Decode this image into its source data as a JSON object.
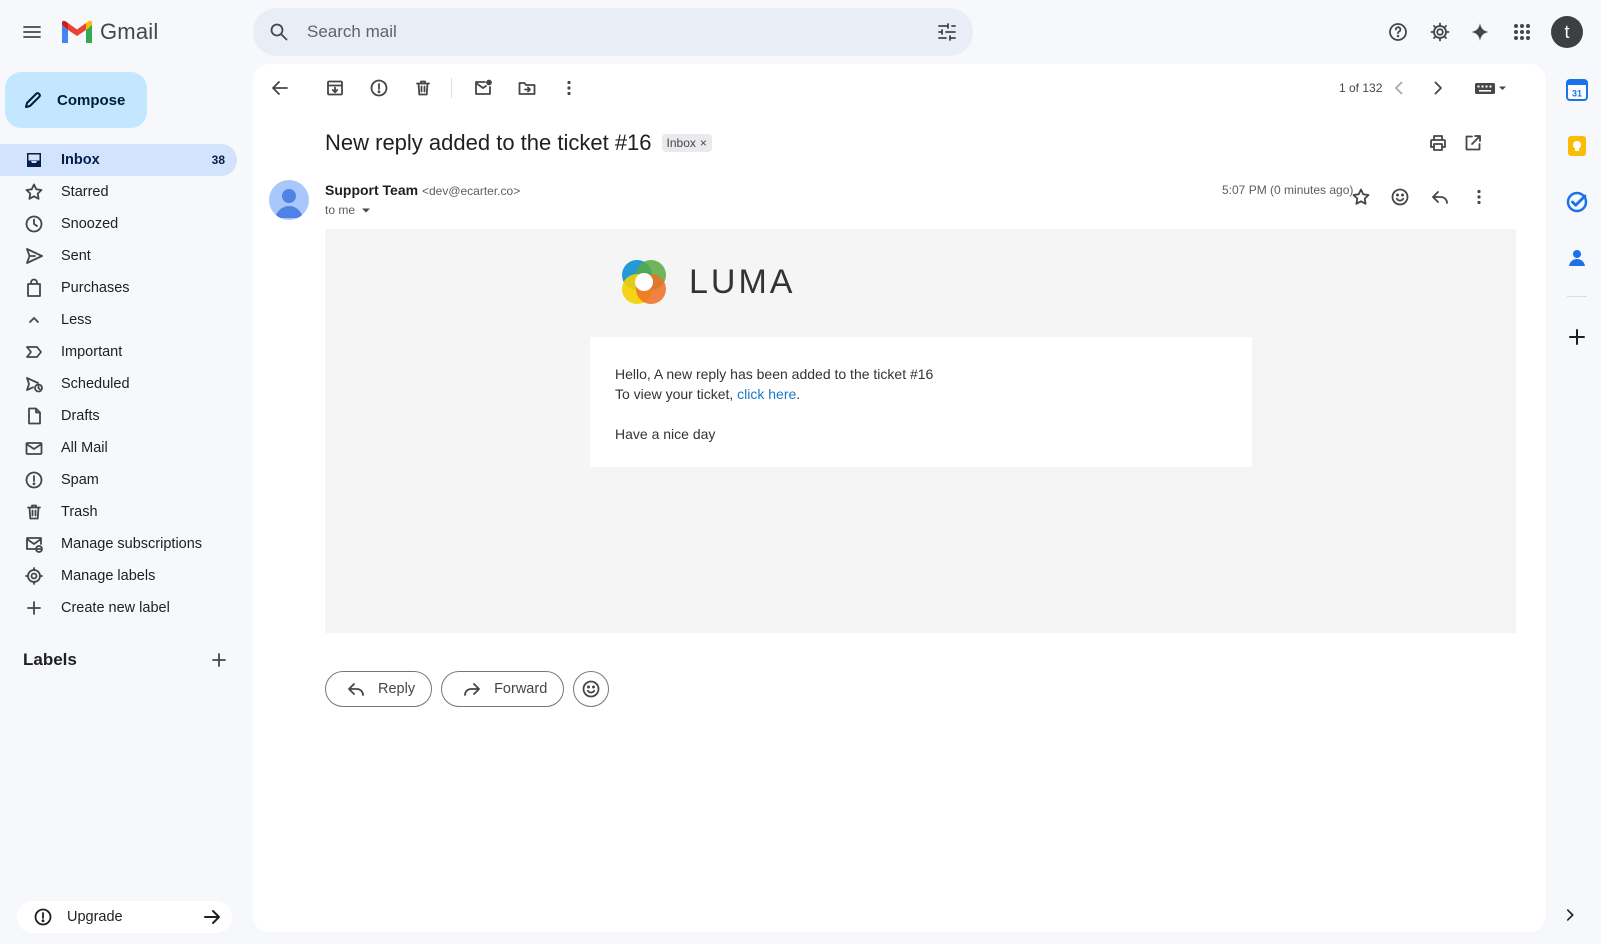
{
  "app": {
    "name": "Gmail"
  },
  "search": {
    "placeholder": "Search mail"
  },
  "account": {
    "initial": "t"
  },
  "compose": {
    "label": "Compose"
  },
  "nav": [
    {
      "label": "Inbox",
      "count": "38",
      "icon": "inbox-icon",
      "active": true
    },
    {
      "label": "Starred",
      "count": "",
      "icon": "star-icon"
    },
    {
      "label": "Snoozed",
      "count": "",
      "icon": "clock-icon"
    },
    {
      "label": "Sent",
      "count": "",
      "icon": "send-icon"
    },
    {
      "label": "Purchases",
      "count": "",
      "icon": "shopping-bag-icon"
    },
    {
      "label": "Less",
      "count": "",
      "icon": "chevron-up-icon"
    },
    {
      "label": "Important",
      "count": "",
      "icon": "label-important-icon"
    },
    {
      "label": "Scheduled",
      "count": "",
      "icon": "scheduled-send-icon"
    },
    {
      "label": "Drafts",
      "count": "",
      "icon": "draft-icon"
    },
    {
      "label": "All Mail",
      "count": "",
      "icon": "all-mail-icon"
    },
    {
      "label": "Spam",
      "count": "",
      "icon": "report-icon"
    },
    {
      "label": "Trash",
      "count": "",
      "icon": "trash-icon"
    },
    {
      "label": "Manage subscriptions",
      "count": "",
      "icon": "unsubscribe-icon"
    },
    {
      "label": "Manage labels",
      "count": "",
      "icon": "gear-icon"
    },
    {
      "label": "Create new label",
      "count": "",
      "icon": "plus-icon"
    }
  ],
  "labels": {
    "heading": "Labels"
  },
  "upgrade": {
    "label": "Upgrade"
  },
  "toolbar": {
    "pager": "1 of 132"
  },
  "message": {
    "subject": "New reply added to the ticket #16",
    "label_tag": "Inbox",
    "sender_name": "Support Team",
    "sender_email": "<dev@ecarter.co>",
    "recipient": "to me",
    "time": "5:07 PM (0 minutes ago)",
    "brand": "LUMA",
    "greeting": "Hello, A new reply has been added to the ticket #16",
    "view_prefix": "To view your ticket, ",
    "view_link": "click here",
    "view_suffix": ".",
    "signoff": "Have a nice day"
  },
  "actions": {
    "reply": "Reply",
    "forward": "Forward"
  },
  "colors": {
    "accent": "#0b57d0",
    "compose_bg": "#c2e7ff",
    "active_nav": "#d3e3fd",
    "link": "#1979c3"
  },
  "side_panel": {
    "calendar_day": "31"
  }
}
